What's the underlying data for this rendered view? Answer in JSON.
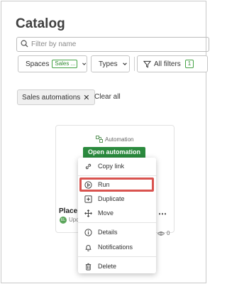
{
  "catalog": {
    "title": "Catalog",
    "search": {
      "placeholder": "Filter by name",
      "icon": "search-icon"
    },
    "filters": {
      "spaces": {
        "label": "Spaces",
        "chip": "Sales ..."
      },
      "types": {
        "label": "Types"
      },
      "all_filters": {
        "label": "All filters",
        "count": "1"
      }
    },
    "selected_filter": {
      "label": "Sales automations",
      "remove": "✕"
    },
    "clear_all": "Clear all"
  },
  "card": {
    "type_label": "Automation",
    "open_button": "Open automation",
    "title": "Place o",
    "avatar_initials": "EL",
    "updated": "Upd",
    "more": "⋯",
    "views": "0"
  },
  "context_menu": {
    "items": [
      {
        "label": "Copy link",
        "icon": "link-icon"
      },
      {
        "label": "Run",
        "icon": "play-icon"
      },
      {
        "label": "Duplicate",
        "icon": "duplicate-icon"
      },
      {
        "label": "Move",
        "icon": "move-icon"
      },
      {
        "label": "Details",
        "icon": "info-icon"
      },
      {
        "label": "Notifications",
        "icon": "bell-icon"
      },
      {
        "label": "Delete",
        "icon": "trash-icon"
      }
    ],
    "highlighted": "Run",
    "highlight_color": "#d9534f"
  },
  "colors": {
    "accent_green": "#2b8a3e",
    "highlight_red": "#d9534f"
  }
}
